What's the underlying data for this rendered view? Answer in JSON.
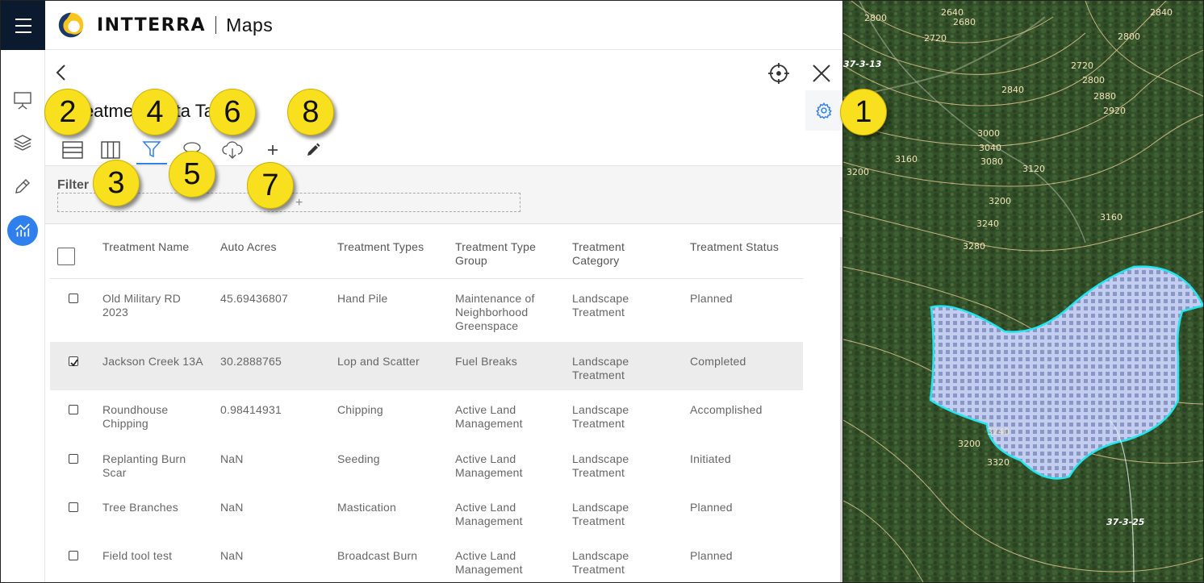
{
  "app": {
    "brand": "INTTERRA",
    "product": "Maps"
  },
  "panel": {
    "title": "Treatment Data Table"
  },
  "toolbar": {
    "buttons": [
      {
        "name": "rows-view-icon",
        "active": false
      },
      {
        "name": "columns-view-icon",
        "active": false
      },
      {
        "name": "filter-icon",
        "active": true
      },
      {
        "name": "lasso-icon",
        "active": false
      },
      {
        "name": "cloud-download-icon",
        "active": false
      },
      {
        "name": "add-icon",
        "active": false
      },
      {
        "name": "edit-pencil-icon",
        "active": false
      }
    ]
  },
  "filter": {
    "label": "Filter",
    "add_symbol": "+"
  },
  "table": {
    "columns": [
      "Treatment Name",
      "Auto Acres",
      "Treatment Types",
      "Treatment Type Group",
      "Treatment Category",
      "Treatment Status"
    ],
    "rows": [
      {
        "checked": false,
        "cells": [
          "Old Military RD 2023",
          "45.69436807",
          "Hand Pile",
          "Maintenance of Neighborhood Greenspace",
          "Landscape Treatment",
          "Planned"
        ]
      },
      {
        "checked": true,
        "cells": [
          "Jackson Creek 13A",
          "30.2888765",
          "Lop and Scatter",
          "Fuel Breaks",
          "Landscape Treatment",
          "Completed"
        ]
      },
      {
        "checked": false,
        "cells": [
          "Roundhouse Chipping",
          "0.98414931",
          "Chipping",
          "Active Land Management",
          "Landscape Treatment",
          "Accomplished"
        ]
      },
      {
        "checked": false,
        "cells": [
          "Replanting Burn Scar",
          "NaN",
          "Seeding",
          "Active Land Management",
          "Landscape Treatment",
          "Initiated"
        ]
      },
      {
        "checked": false,
        "cells": [
          "Tree Branches",
          "NaN",
          "Mastication",
          "Active Land Management",
          "Landscape Treatment",
          "Planned"
        ]
      },
      {
        "checked": false,
        "cells": [
          "Field tool test",
          "NaN",
          "Broadcast Burn",
          "Active Land Management",
          "Landscape Treatment",
          "Planned"
        ]
      }
    ]
  },
  "map": {
    "contour_labels": [
      "2800",
      "2640",
      "2680",
      "2720",
      "2800",
      "2840",
      "2720",
      "2800",
      "2880",
      "2920",
      "2840",
      "3000",
      "3040",
      "3080",
      "3120",
      "3160",
      "3200",
      "3200",
      "3160",
      "3240",
      "3280",
      "3240",
      "3200",
      "3320"
    ],
    "road_labels": [
      "37-3-13",
      "37-3-25"
    ],
    "polygon_label": "ACTIVE",
    "colors": {
      "polygon_outline": "#22e6f0",
      "polygon_fill": "#b9c4e8"
    }
  },
  "callouts": [
    "1",
    "2",
    "3",
    "4",
    "5",
    "6",
    "7",
    "8"
  ],
  "colors": {
    "accent": "#2f80ed",
    "nav_dark": "#0b1a2e",
    "callout": "#f8e01e"
  }
}
